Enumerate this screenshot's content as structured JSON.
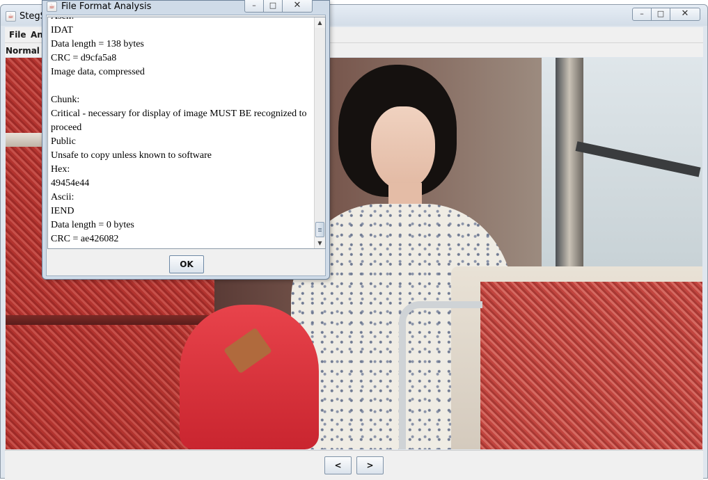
{
  "main_window": {
    "title": "StegS",
    "menu": {
      "file": "File",
      "analyse": "An"
    },
    "mode_label": "Normal Ir",
    "nav": {
      "prev": "<",
      "next": ">"
    },
    "controls": {
      "minimize": "–",
      "maximize": "□",
      "close": "✕"
    }
  },
  "dialog": {
    "title": "File Format Analysis",
    "controls": {
      "minimize": "–",
      "maximize": "□",
      "close": "✕"
    },
    "lines": [
      "Ascii:",
      "IDAT",
      "Data length = 138 bytes",
      "CRC = d9cfa5a8",
      "Image data, compressed",
      "",
      "Chunk:",
      "Critical - necessary for display of image MUST BE recognized to",
      "proceed",
      "Public",
      "Unsafe to copy unless known to software",
      "Hex:",
      "49454e44",
      "Ascii:",
      "IEND",
      "Data length = 0 bytes",
      "CRC = ae426082"
    ],
    "ok_label": "OK",
    "scroll_up": "▲",
    "scroll_down": "▼"
  },
  "icons": {
    "app": "java-cup-icon"
  },
  "colors": {
    "window_frame": "#dfe6ee",
    "dialog_frame": "#cfdbe8",
    "seat_red": "#b83a36",
    "backpack_red": "#e03440"
  }
}
